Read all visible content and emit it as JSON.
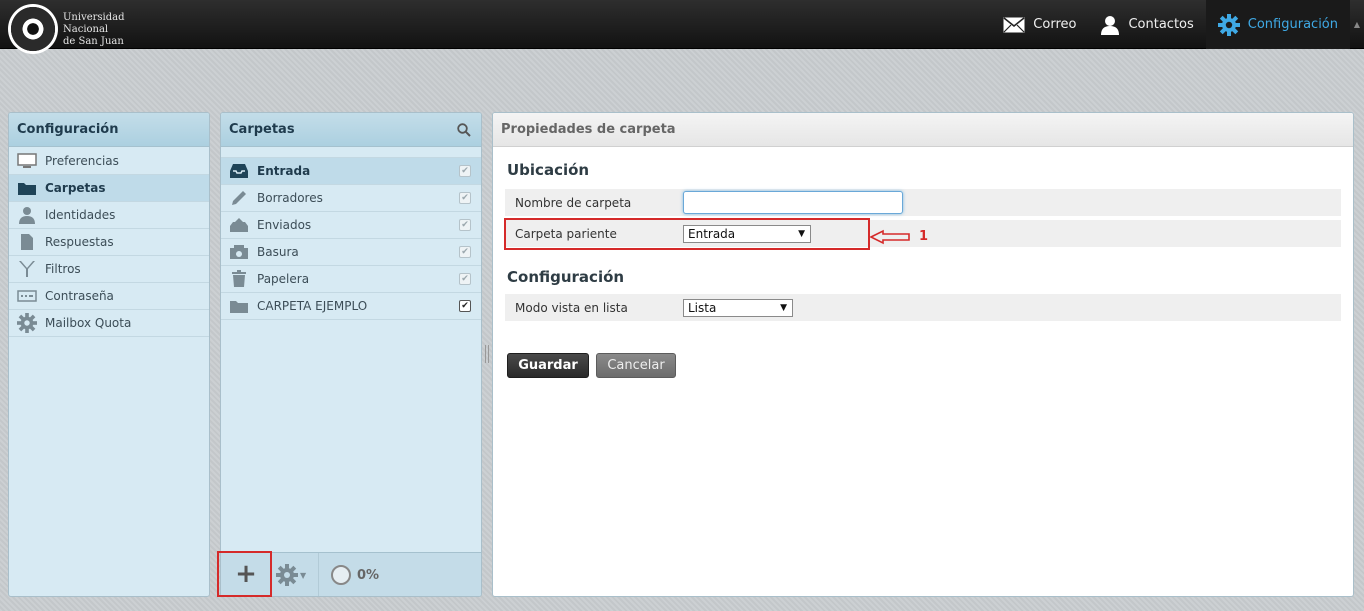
{
  "brand": {
    "line1": "Universidad",
    "line2": "Nacional",
    "line3": "de San Juan"
  },
  "topnav": {
    "mail": "Correo",
    "contacts": "Contactos",
    "settings": "Configuración",
    "active_color": "#3fa9e5"
  },
  "settings_panel": {
    "title": "Configuración",
    "items": [
      {
        "label": "Preferencias",
        "icon": "monitor-icon"
      },
      {
        "label": "Carpetas",
        "icon": "folder-icon"
      },
      {
        "label": "Identidades",
        "icon": "user-icon"
      },
      {
        "label": "Respuestas",
        "icon": "document-icon"
      },
      {
        "label": "Filtros",
        "icon": "filter-icon"
      },
      {
        "label": "Contraseña",
        "icon": "password-icon"
      },
      {
        "label": "Mailbox Quota",
        "icon": "gear-icon"
      }
    ],
    "selected": "Carpetas"
  },
  "folders_panel": {
    "title": "Carpetas",
    "items": [
      {
        "label": "Entrada",
        "icon": "inbox-icon",
        "subscribed": true
      },
      {
        "label": "Borradores",
        "icon": "pencil-icon",
        "subscribed": true
      },
      {
        "label": "Enviados",
        "icon": "sent-icon",
        "subscribed": true
      },
      {
        "label": "Basura",
        "icon": "junk-icon",
        "subscribed": true
      },
      {
        "label": "Papelera",
        "icon": "trash-icon",
        "subscribed": true
      },
      {
        "label": "CARPETA EJEMPLO",
        "icon": "folder-icon",
        "subscribed": true
      }
    ],
    "add_symbol": "+",
    "quota": "0%"
  },
  "properties": {
    "title": "Propiedades de carpeta",
    "location_title": "Ubicación",
    "folder_name_label": "Nombre de carpeta",
    "folder_name_value": "",
    "parent_label": "Carpeta pariente",
    "parent_value": "Entrada",
    "config_title": "Configuración",
    "view_mode_label": "Modo vista en lista",
    "view_mode_value": "Lista",
    "save_label": "Guardar",
    "cancel_label": "Cancelar"
  },
  "annotation": {
    "number": "1",
    "color": "#d52a2a"
  }
}
